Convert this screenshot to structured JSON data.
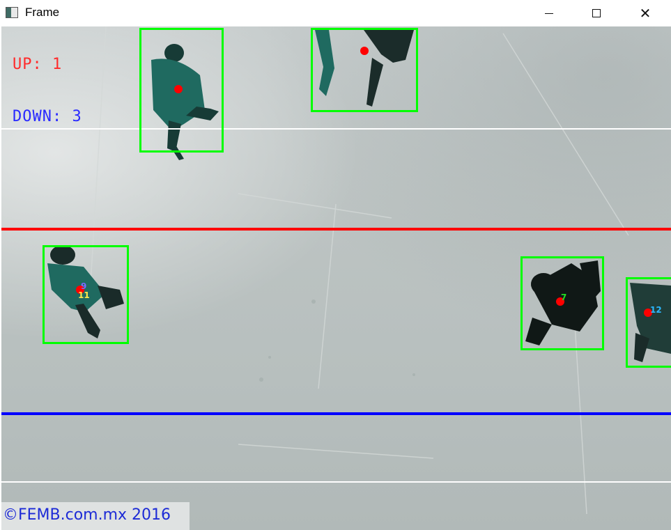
{
  "window": {
    "title": "Frame",
    "icon": "app-window-icon",
    "controls": {
      "minimize": "minimize-icon",
      "maximize": "maximize-icon",
      "close": "close-icon"
    }
  },
  "counters": {
    "up_label": "UP: 1",
    "down_label": "DOWN: 3",
    "up_color": "#ff2020",
    "down_color": "#2020ff"
  },
  "lines": {
    "top_limit_color": "#ffffff",
    "up_line_color": "#ff0000",
    "down_line_color": "#0000ff",
    "bottom_limit_color": "#ffffff"
  },
  "tracks": [
    {
      "id": "",
      "id_color": "#2bd6ff"
    },
    {
      "id": "",
      "id_color": "#2bd6ff"
    },
    {
      "id": "9",
      "id_color": "#7b6bff",
      "extra_id": "11",
      "extra_color": "#ffe94a"
    },
    {
      "id": "7",
      "id_color": "#22dd22"
    },
    {
      "id": "12",
      "id_color": "#2bb7ff"
    }
  ],
  "box_color": "#00ff00",
  "centroid_color": "#ff0000",
  "watermark": {
    "text": "©FEMB.com.mx 2016",
    "color": "#1d2bd6"
  }
}
